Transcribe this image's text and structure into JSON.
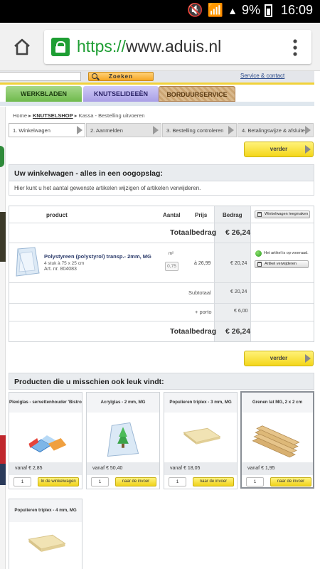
{
  "status_bar": {
    "battery": "9%",
    "time": "16:09"
  },
  "browser": {
    "scheme": "https://",
    "host": "www.aduis.nl"
  },
  "header": {
    "search_button": "Zoeken",
    "service_link": "Service & contact",
    "tabs": [
      "WERKBLADEN",
      "KNUTSELIDEEËN",
      "BORDUURSERVICE"
    ]
  },
  "breadcrumb": {
    "home": "Home",
    "shop": "KNUTSELSHOP",
    "current": "Kassa - Bestelling uitvoeren",
    "sep": "▸"
  },
  "steps": [
    "1. Winkelwagen",
    "2. Aanmelden",
    "3. Bestelling controleren",
    "4. Betalingswijze & afsluiten"
  ],
  "verder_label": "verder",
  "cart_section": {
    "title": "Uw winkelwagen - alles in een oogopslag:",
    "intro": "Hier kunt u het aantal gewenste artikelen wijzigen of artikelen verwijderen."
  },
  "cart": {
    "headers": {
      "product": "product",
      "aantal": "Aantal",
      "prijs": "Prijs",
      "bedrag": "Bedrag"
    },
    "clear_button": "Winkelwagen leegmaken",
    "totaal_label": "Totaalbedrag",
    "totaal_value": "€ 26,24",
    "item": {
      "name": "Polystyreen (polystyrol) transp.- 2mm, MG",
      "desc": "4 stuk à 75 x 25 cm",
      "artnr": "Art. nr. 804083",
      "unit": "m²",
      "qty": "0,75",
      "price": "à 26,99",
      "amount": "€ 20,24",
      "stock": "Het artikel is op voorraad.",
      "remove_button": "Artikel verwijderen"
    },
    "subtotaal_label": "Subtotaal",
    "subtotaal_value": "€ 20,24",
    "porto_label": "+ porto",
    "porto_value": "€ 6,00"
  },
  "suggest_section": {
    "title": "Producten die u misschien ook leuk vindt:"
  },
  "products": [
    {
      "title": "Plexiglas - servettenhouder 'Bistro'",
      "price": "vanaf € 2,85",
      "qty": "1",
      "button": "In de winkelwagen"
    },
    {
      "title": "Acrylglas - 2 mm, MG",
      "price": "vanaf € 50,40",
      "qty": "1",
      "button": "naar de invoer"
    },
    {
      "title": "Populieren triplex - 3 mm, MG",
      "price": "vanaf € 18,05",
      "qty": "1",
      "button": "naar de invoer"
    },
    {
      "title": "Grenen lat MG, 2 x 2 cm",
      "price": "vanaf € 1,95",
      "qty": "1",
      "button": "naar de invoer"
    },
    {
      "title": "Populieren triplex - 4 mm, MG"
    }
  ],
  "colors": {
    "accent_yellow": "#f4d61a",
    "url_green": "#1e9e33",
    "tab_green": "#6fba4c",
    "tab_purple": "#a99fe6"
  }
}
